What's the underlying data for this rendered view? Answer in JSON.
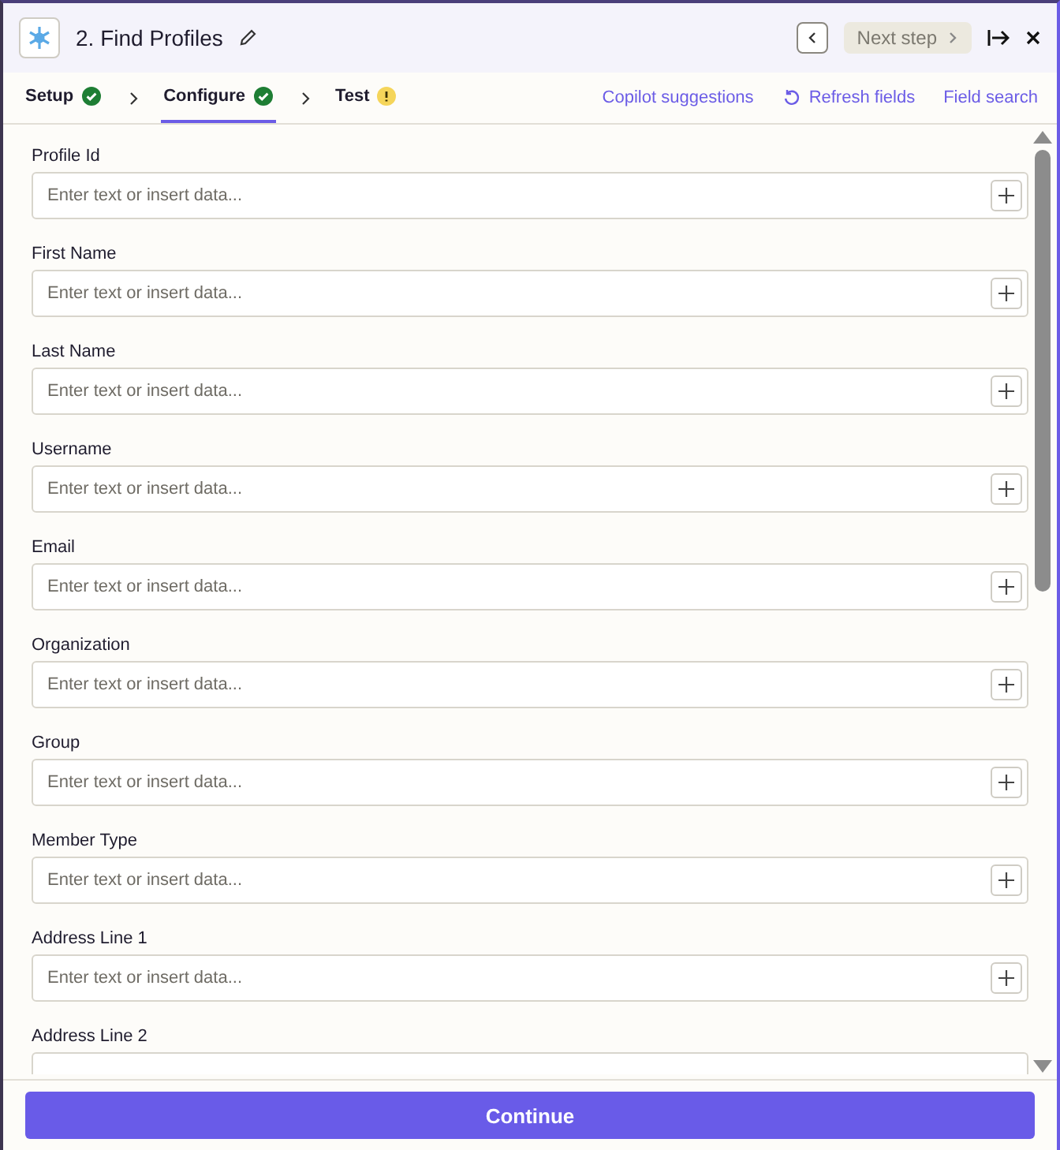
{
  "header": {
    "title": "2. Find Profiles",
    "next_step": "Next step"
  },
  "tabs": [
    {
      "label": "Setup",
      "kind": "complete",
      "selected": false
    },
    {
      "label": "Configure",
      "kind": "complete",
      "selected": true
    },
    {
      "label": "Test",
      "kind": "warning",
      "selected": false
    }
  ],
  "actions": [
    "Copilot suggestions",
    "Refresh fields",
    "Field search"
  ],
  "fields": [
    {
      "label": "Profile Id",
      "placeholder": "Enter text or insert data..."
    },
    {
      "label": "First Name",
      "placeholder": "Enter text or insert data..."
    },
    {
      "label": "Last Name",
      "placeholder": "Enter text or insert data..."
    },
    {
      "label": "Username",
      "placeholder": "Enter text or insert data..."
    },
    {
      "label": "Email",
      "placeholder": "Enter text or insert data..."
    },
    {
      "label": "Organization",
      "placeholder": "Enter text or insert data..."
    },
    {
      "label": "Group",
      "placeholder": "Enter text or insert data..."
    },
    {
      "label": "Member Type",
      "placeholder": "Enter text or insert data..."
    },
    {
      "label": "Address Line 1",
      "placeholder": "Enter text or insert data..."
    },
    {
      "label": "Address Line 2"
    }
  ],
  "continue_button": "Continue"
}
